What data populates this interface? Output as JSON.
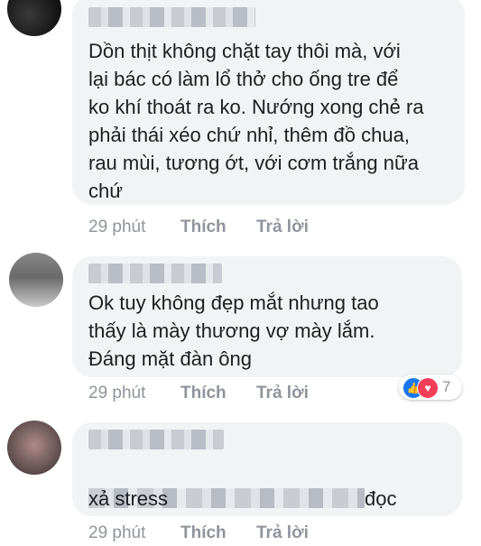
{
  "comments": [
    {
      "text": "Dồn thịt không chặt tay thôi mà, với\nlại bác có làm lổ thở cho ống tre để\nko khí thoát ra ko. Nướng xong chẻ ra\nphải thái xéo chứ nhỉ, thêm đồ chua,\nrau mùi, tương ớt, với cơm trắng nữa\nchứ",
      "time": "29 phút",
      "like_label": "Thích",
      "reply_label": "Trả lời"
    },
    {
      "text": "Ok tuy không đẹp mắt nhưng tao\nthấy là mày thương vợ mày lắm.\nĐáng mặt đàn ông",
      "time": "29 phút",
      "like_label": "Thích",
      "reply_label": "Trả lời",
      "reactions": {
        "icons": [
          "like-icon",
          "love-icon"
        ],
        "count": "7"
      }
    },
    {
      "text_end": "đọc",
      "text_line2": "xả stress",
      "time": "29 phút",
      "like_label": "Thích",
      "reply_label": "Trả lời"
    }
  ],
  "colors": {
    "bubble": "#f2f3f5",
    "action_text": "#90949c",
    "like_reaction": "#1877f2",
    "love_reaction": "#f33e58"
  }
}
